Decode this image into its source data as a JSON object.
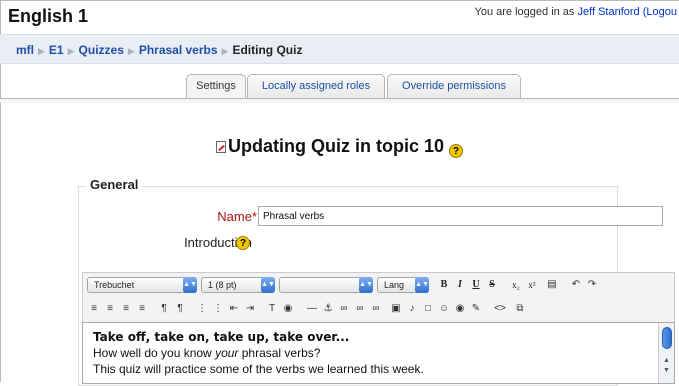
{
  "site": {
    "title": "English 1",
    "login_prefix": "You are logged in as",
    "user_name": "Jeff Stanford",
    "logout": "(Logou"
  },
  "breadcrumb": [
    "mfl",
    "E1",
    "Quizzes",
    "Phrasal verbs"
  ],
  "breadcrumb_current": "Editing Quiz",
  "tabs": [
    "Settings",
    "Locally assigned roles",
    "Override permissions"
  ],
  "heading": "Updating Quiz in topic 10",
  "form": {
    "legend": "General",
    "name_label": "Name",
    "required_mark": "*",
    "name_value": "Phrasal verbs",
    "intro_label": "Introduction"
  },
  "editor": {
    "font_family": "Trebuchet",
    "font_size": "1 (8 pt)",
    "format": "",
    "lang": "Lang",
    "content": [
      "Take off, take on, take up, take over...",
      "How well do you know ",
      "your",
      " phrasal verbs?",
      "This quiz will practice some of the verbs we learned this week."
    ]
  },
  "colors": {
    "link": "#1d4fa6",
    "navbar": "#e9eef4",
    "required": "#cc0000"
  }
}
